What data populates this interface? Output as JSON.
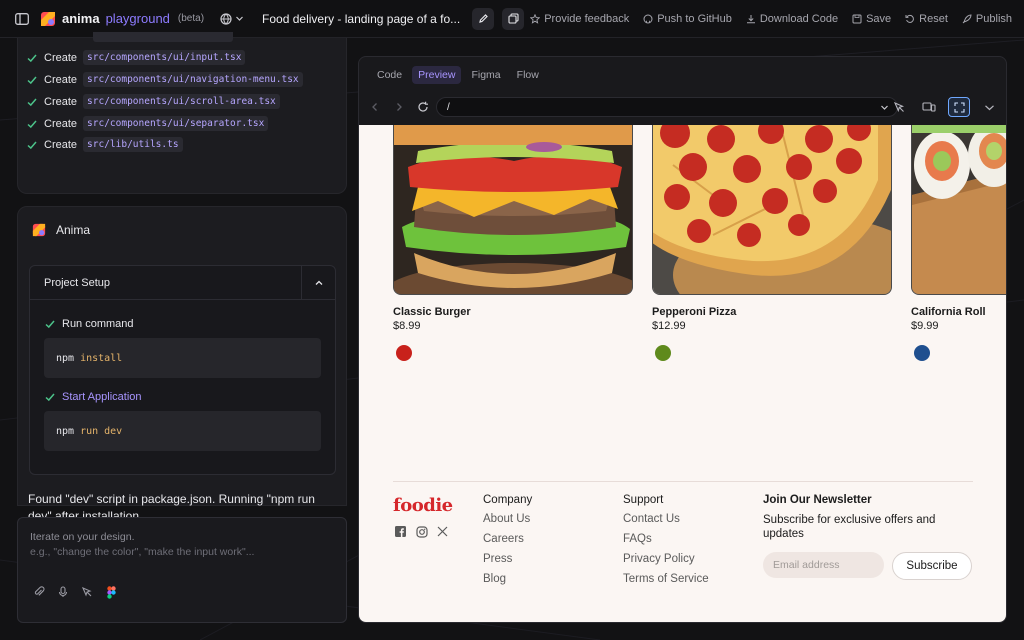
{
  "topbar": {
    "brand_name": "anima",
    "brand_product": "playground",
    "brand_tag": "(beta)",
    "project_title": "Food delivery - landing page of a fo...",
    "actions": [
      {
        "label": "Provide feedback",
        "icon": "star-icon"
      },
      {
        "label": "Push to GitHub",
        "icon": "github-icon"
      },
      {
        "label": "Download Code",
        "icon": "download-icon"
      },
      {
        "label": "Save",
        "icon": "save-icon"
      },
      {
        "label": "Reset",
        "icon": "reset-icon"
      },
      {
        "label": "Publish",
        "icon": "rocket-icon"
      }
    ]
  },
  "files": {
    "create_label": "Create",
    "items": [
      "src/components/ui/input.tsx",
      "src/components/ui/navigation-menu.tsx",
      "src/components/ui/scroll-area.tsx",
      "src/components/ui/separator.tsx",
      "src/lib/utils.ts"
    ]
  },
  "anima": {
    "name": "Anima",
    "setup_title": "Project Setup",
    "step1_label": "Run command",
    "step1_cmd": "npm",
    "step1_arg": "install",
    "step2_label": "Start Application",
    "step2_cmd": "npm",
    "step2_arg": "run dev",
    "found_text": "Found \"dev\" script in package.json. Running \"npm run dev\" after installation..."
  },
  "prompt": {
    "placeholder1": "Iterate on your design.",
    "placeholder2": "e.g., \"change the color\", \"make the input work\"..."
  },
  "preview": {
    "tabs": [
      "Code",
      "Preview",
      "Figma",
      "Flow"
    ],
    "active_tab": "Preview",
    "url": "/"
  },
  "site": {
    "foods": [
      {
        "name": "Classic Burger",
        "price": "$8.99",
        "color": "#c8211b"
      },
      {
        "name": "Pepperoni Pizza",
        "price": "$12.99",
        "color": "#5f8a1c"
      },
      {
        "name": "California Roll",
        "price": "$9.99",
        "color": "#1f4f8f"
      }
    ],
    "logo": "foodie",
    "company": {
      "title": "Company",
      "items": [
        "About Us",
        "Careers",
        "Press",
        "Blog"
      ]
    },
    "support": {
      "title": "Support",
      "items": [
        "Contact Us",
        "FAQs",
        "Privacy Policy",
        "Terms of Service"
      ]
    },
    "newsletter": {
      "title": "Join Our Newsletter",
      "desc": "Subscribe for exclusive offers and updates",
      "placeholder": "Email address",
      "button": "Subscribe"
    }
  },
  "colors": {
    "accent": "#8d7bff",
    "check": "#4cc38a",
    "brand_red": "#d5272b"
  }
}
